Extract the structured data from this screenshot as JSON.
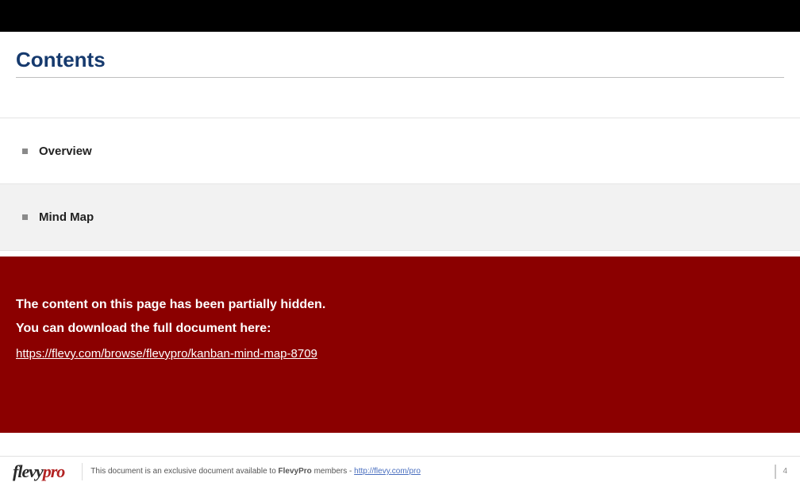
{
  "title": "Contents",
  "sections": {
    "overview_label": "Overview",
    "mindmap_label": "Mind Map"
  },
  "overlay": {
    "line1": "The content on this page has been partially hidden.",
    "line2": "You can download the full document here:",
    "link_text": "https://flevy.com/browse/flevypro/kanban-mind-map-8709"
  },
  "footer": {
    "brand_flevy": "flevy",
    "brand_pro": "pro",
    "text_prefix": "This document is an exclusive document available to ",
    "text_bold": "FlevyPro",
    "text_mid": " members - ",
    "link_text": "http://flevy.com/pro",
    "page_number": "4"
  }
}
